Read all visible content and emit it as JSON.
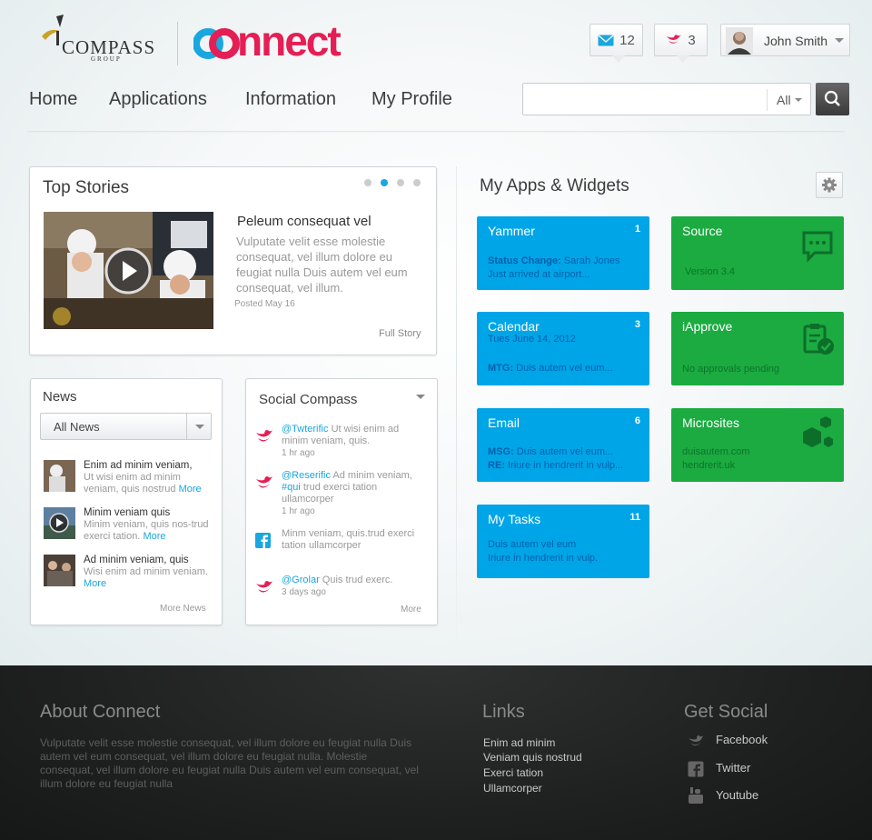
{
  "header": {
    "logo_compass_word": "COMPASS",
    "logo_compass_sub": "GROUP",
    "logo_connect": "connect",
    "messages_count": "12",
    "tweets_count": "3",
    "user_name": "John Smith"
  },
  "nav": {
    "items": [
      "Home",
      "Applications",
      "Information",
      "My Profile"
    ]
  },
  "search": {
    "value": "",
    "filter": "All"
  },
  "top_stories": {
    "title": "Top Stories",
    "story_title": "Peleum consequat vel",
    "story_body": "Vulputate velit esse molestie consequat, vel illum dolore eu feugiat nulla Duis autem vel eum consequat, vel illum.",
    "posted": "Posted May 16",
    "full_story": "Full Story",
    "active_dot": 1
  },
  "news": {
    "title": "News",
    "filter": "All News",
    "items": [
      {
        "title": "Enim ad minim veniam,",
        "body": "Ut wisi enim ad minim veniam, quis nostrud",
        "more": "More"
      },
      {
        "title": "Minim veniam quis",
        "body": "Minim veniam, quis nos-trud exerci tation.",
        "more": "More"
      },
      {
        "title": "Ad minim veniam, quis",
        "body": "Wisi enim ad minim veniam.",
        "more": "More"
      }
    ],
    "more_news": "More News"
  },
  "social": {
    "title": "Social Compass",
    "items": [
      {
        "icon": "twitter-icon",
        "handle": "@Twterific",
        "text": " Ut wisi enim ad minim veniam, quis.",
        "time": "1 hr ago"
      },
      {
        "icon": "twitter-icon",
        "handle": "@Reserific",
        "text": " Ad minim veniam, ",
        "tag": "#qui",
        "text2": " trud exerci tation ullamcorper",
        "time": "1 hr ago"
      },
      {
        "icon": "facebook-icon",
        "handle": "",
        "text": "Minm veniam, quis.trud exerci tation ullamcorper",
        "time": ""
      },
      {
        "icon": "twitter-icon",
        "handle": "@Grolar",
        "text": " Quis trud exerc.",
        "time": "3 days ago"
      }
    ],
    "more": "More"
  },
  "apps": {
    "title": "My Apps & Widgets",
    "tiles": [
      {
        "title": "Yammer",
        "count": "1",
        "l1_bold": "Status Change:",
        "l1": " Sarah Jones",
        "l2_bold": "",
        "l2": "Just arrived at airport..."
      },
      {
        "title": "Source",
        "count": "",
        "l1_bold": "",
        "l1": "",
        "l2_bold": "",
        "l2": "Version 3.4",
        "icon": "chat-icon"
      },
      {
        "title": "Calendar",
        "count": "3",
        "l1_bold": "",
        "l1": "Tues June 14, 2012",
        "l2_bold": "MTG:",
        "l2": " Duis autem vel eum..."
      },
      {
        "title": "iApprove",
        "count": "",
        "l1_bold": "",
        "l1": "",
        "l2_bold": "",
        "l2": "No approvals pending",
        "icon": "clipboard-check-icon"
      },
      {
        "title": "Email",
        "count": "6",
        "l1_bold": "MSG:",
        "l1": " Duis autem vel eum...",
        "l2_bold": "RE:",
        "l2": " Iriure  in hendrerit in vulp..."
      },
      {
        "title": "Microsites",
        "count": "",
        "l1_bold": "",
        "l1": "duisautem.com",
        "l2_bold": "",
        "l2": "hendrerit.uk",
        "icon": "cubes-icon"
      },
      {
        "title": "My Tasks",
        "count": "11",
        "l1_bold": "",
        "l1": "Duis autem vel eum",
        "l2_bold": "",
        "l2": "Iriure  in hendrerit in vulp."
      }
    ]
  },
  "footer": {
    "about_title": "About Connect",
    "about_text": "Vulputate velit esse molestie consequat, vel illum dolore eu feugiat nulla Duis autem vel eum consequat, vel illum dolore eu feugiat nulla. Molestie consequat, vel illum dolore eu feugiat nulla Duis autem vel eum consequat, vel illum dolore eu feugiat nulla",
    "links_title": "Links",
    "links": [
      "Enim ad minim",
      "Veniam quis nostrud",
      "Exerci tation",
      "Ullamcorper"
    ],
    "social_title": "Get Social",
    "social": [
      "Facebook",
      "Twitter",
      "Youtube"
    ]
  },
  "colors": {
    "brand_pink": "#e41f55",
    "brand_blue": "#1aa6de",
    "tile_blue": "#00a5e8",
    "tile_green": "#1bab41"
  }
}
